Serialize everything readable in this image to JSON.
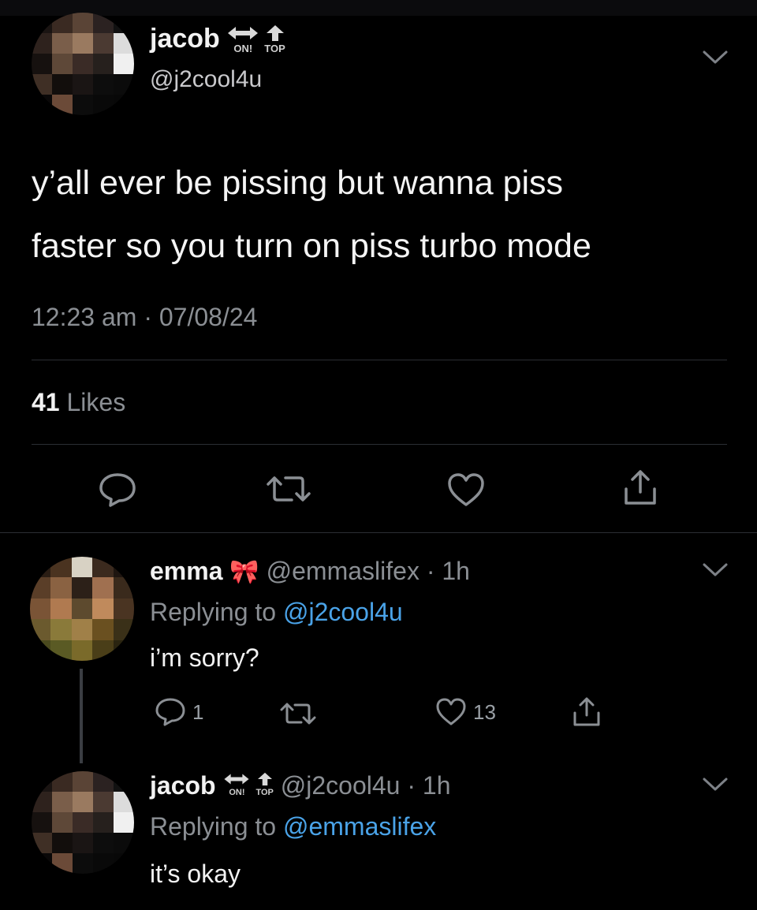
{
  "main_tweet": {
    "display_name": "jacob",
    "badge_left": "ON!",
    "badge_right": "TOP",
    "handle": "@j2cool4u",
    "text_line1": "y’all ever be pissing but wanna piss",
    "text_line2": "faster so you turn on piss turbo mode",
    "timestamp": "12:23 am · 07/08/24",
    "likes_count": "41",
    "likes_label": "Likes"
  },
  "reply1": {
    "display_name": "emma",
    "emoji": "🎀",
    "handle_time": "@emmaslifex · 1h",
    "replying_prefix": "Replying to",
    "replying_handle": "@j2cool4u",
    "text": "i’m sorry?",
    "reply_count": "1",
    "like_count": "13"
  },
  "reply2": {
    "display_name": "jacob",
    "badge_left": "ON!",
    "badge_right": "TOP",
    "handle_time": "@j2cool4u · 1h",
    "replying_prefix": "Replying to",
    "replying_handle": "@emmaslifex",
    "text": "it’s okay"
  },
  "colors": {
    "background": "#000000",
    "secondary_text": "#8b8f94",
    "link": "#4aa3e8",
    "divider": "#2b2e33"
  },
  "icons": [
    "reply-icon",
    "retweet-icon",
    "heart-icon",
    "share-icon",
    "chevron-down-icon",
    "arrows-horizontal-icon",
    "arrow-up-icon"
  ]
}
